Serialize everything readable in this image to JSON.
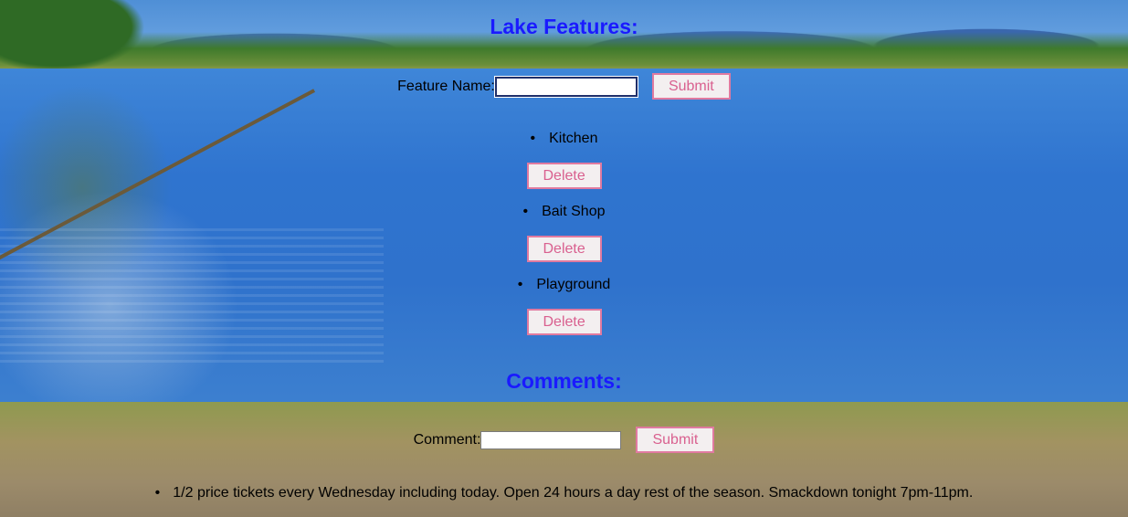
{
  "features_section": {
    "title": "Lake Features:",
    "form": {
      "label": "Feature Name:",
      "input_value": "",
      "submit_label": "Submit"
    },
    "items": [
      {
        "name": "Kitchen",
        "delete_label": "Delete"
      },
      {
        "name": "Bait Shop",
        "delete_label": "Delete"
      },
      {
        "name": "Playground",
        "delete_label": "Delete"
      }
    ]
  },
  "comments_section": {
    "title": "Comments:",
    "form": {
      "label": "Comment:",
      "input_value": "",
      "submit_label": "Submit"
    },
    "items": [
      {
        "text": "1/2 price tickets every Wednesday including today. Open 24 hours a day rest of the season. Smackdown tonight 7pm-11pm."
      }
    ]
  },
  "colors": {
    "heading": "#1a1aff",
    "button_text": "#d9608f",
    "button_border": "#e07aa0"
  }
}
